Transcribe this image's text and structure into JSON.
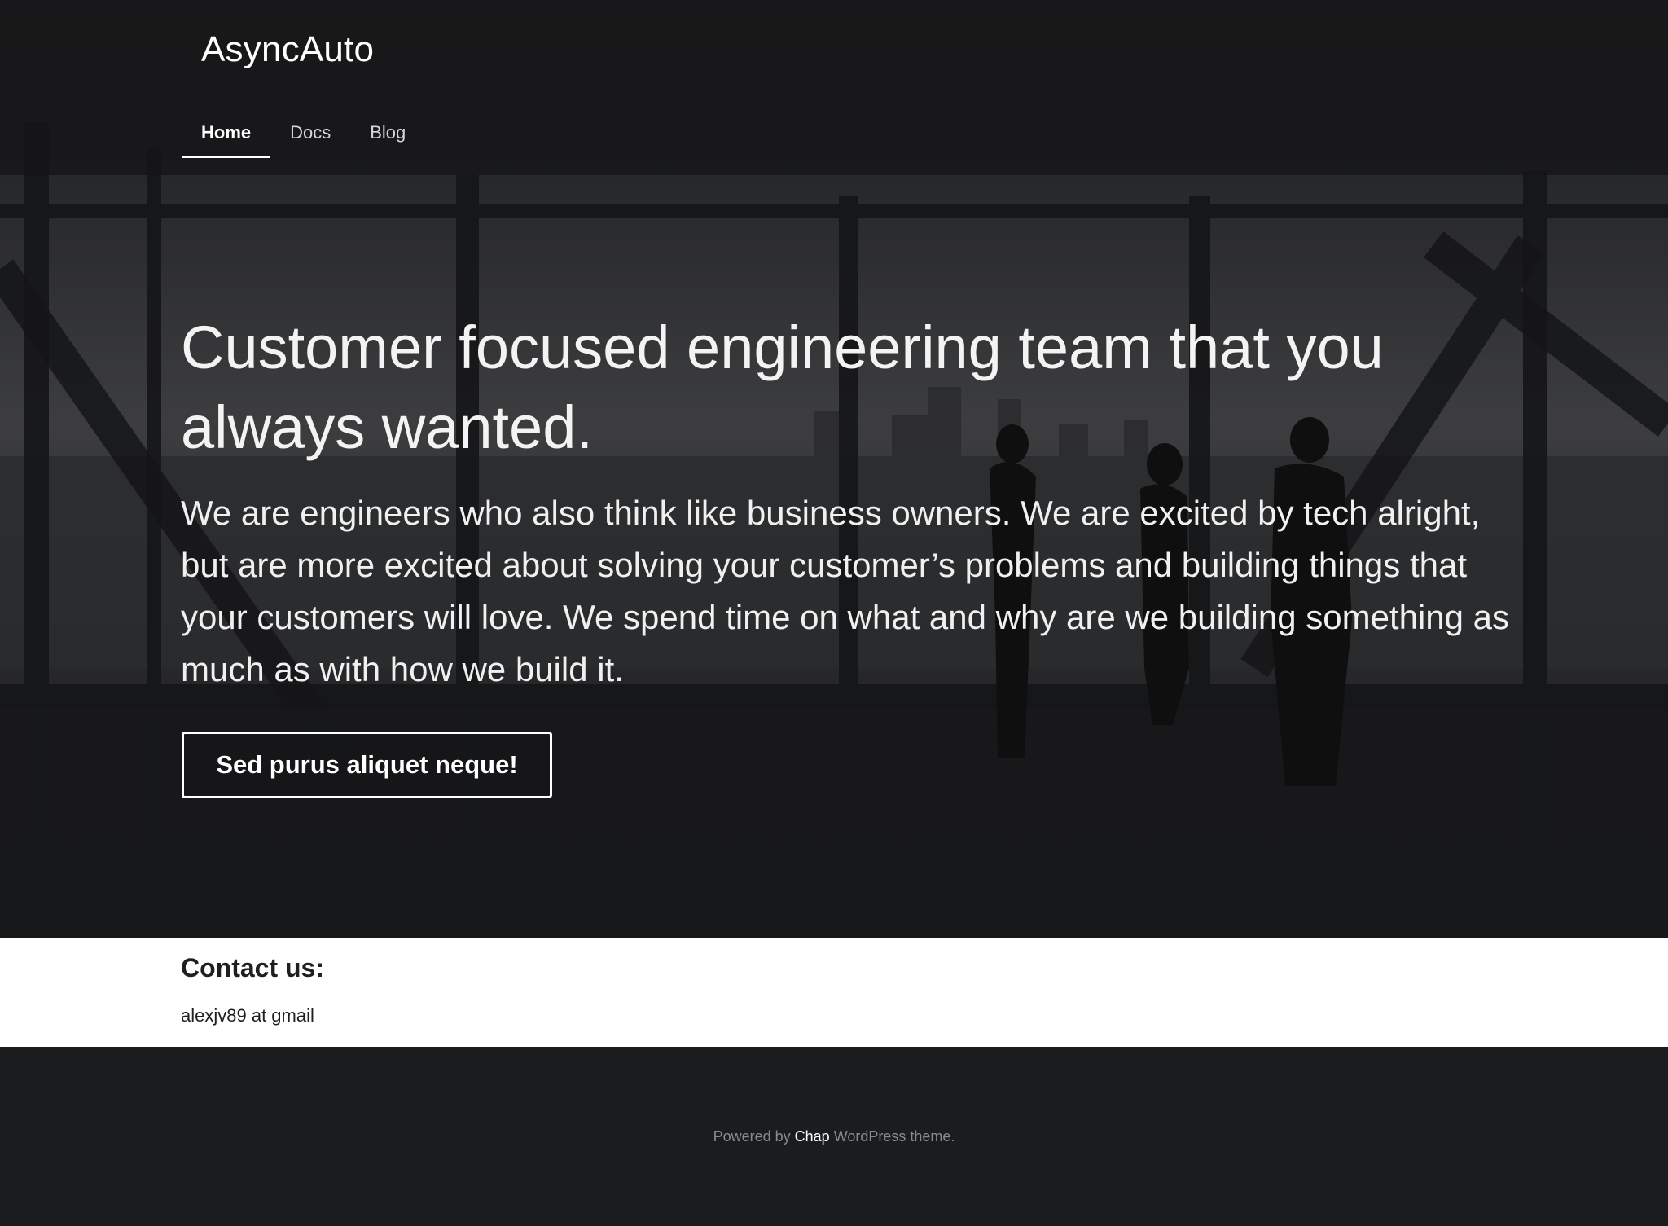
{
  "site": {
    "brand": "AsyncAuto"
  },
  "nav": {
    "items": [
      {
        "label": "Home",
        "active": true
      },
      {
        "label": "Docs",
        "active": false
      },
      {
        "label": "Blog",
        "active": false
      }
    ]
  },
  "hero": {
    "headline": "Customer focused engineering team that you always wanted.",
    "lead": "We are engineers who also think like business owners. We are excited by tech alright, but are more excited about solving your customer’s problems and building things that your customers will love. We spend time on what and why are we building something as much as with how we build it.",
    "cta_label": "Sed purus aliquet neque!"
  },
  "contact": {
    "title": "Contact us:",
    "email": "alexjv89 at gmail"
  },
  "footer": {
    "prefix": "Powered by",
    "link": "Chap",
    "suffix": "WordPress theme."
  },
  "colors": {
    "hero_overlay": "#2f3032",
    "footer_bg": "#1b1c1e",
    "text_light": "#ffffff",
    "text_dark": "#1e1f21",
    "footer_text": "#8a8b8d"
  }
}
